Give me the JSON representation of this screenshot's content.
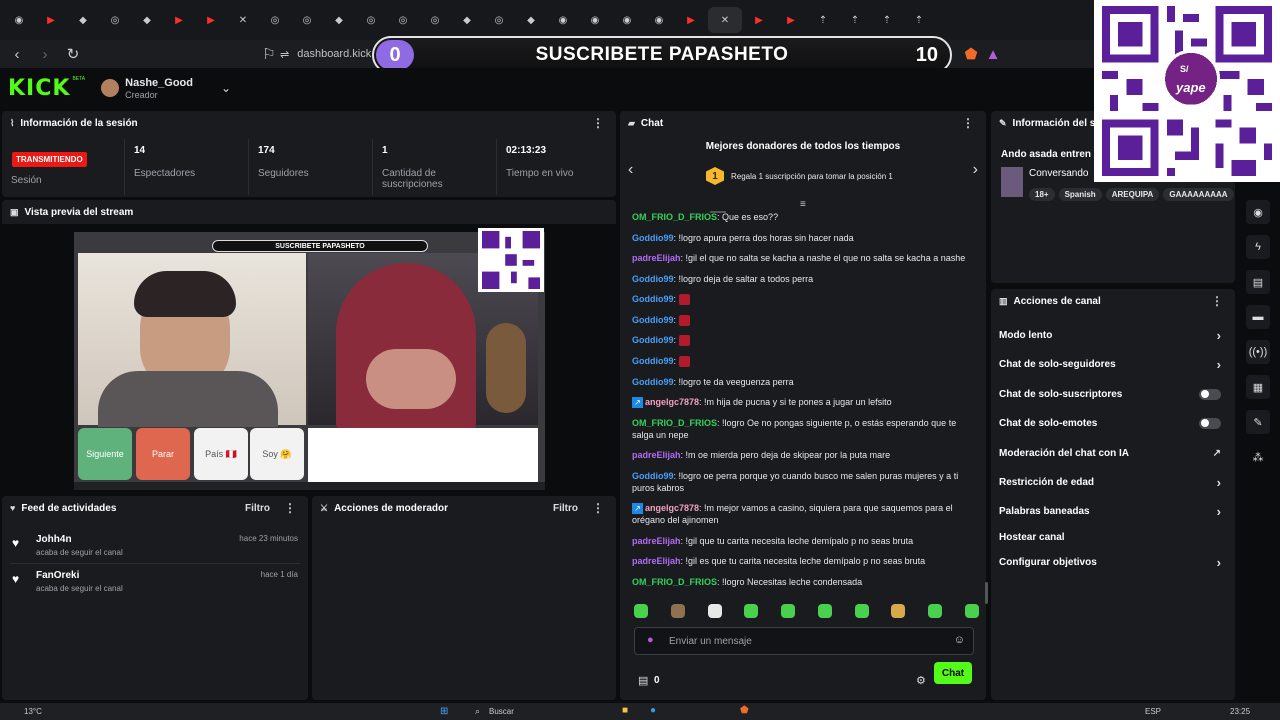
{
  "browser": {
    "url": "dashboard.kick.com/creator/nashe-good"
  },
  "overlay": {
    "sub_count": "0",
    "title": "SUSCRIBETE PAPASHETO",
    "goal": "10",
    "qr_brand": "yape",
    "qr_currency": "S/"
  },
  "header": {
    "logo": "KICK",
    "beta": "BETA",
    "username": "Nashe_Good",
    "role": "Creador"
  },
  "session": {
    "title": "Información de la sesión",
    "status_badge": "TRANSMITIENDO",
    "status_label": "Sesión",
    "stats": [
      {
        "value": "14",
        "label": "Espectadores"
      },
      {
        "value": "174",
        "label": "Seguidores"
      },
      {
        "value": "1",
        "label": "Cantidad de suscripciones"
      },
      {
        "value": "02:13:23",
        "label": "Tiempo en vivo"
      }
    ]
  },
  "preview": {
    "title": "Vista previa del stream",
    "buttons": [
      "Siguiente",
      "Parar",
      "País 🇵🇪",
      "Soy 🤗"
    ]
  },
  "feed": {
    "title": "Feed de actividades",
    "filter": "Filtro",
    "items": [
      {
        "name": "Johh4n",
        "desc": "acaba de seguir el canal",
        "time": "hace 23 minutos"
      },
      {
        "name": "FanOreki",
        "desc": "acaba de seguir el canal",
        "time": "hace 1 día"
      }
    ]
  },
  "moderator": {
    "title": "Acciones de moderador",
    "filter": "Filtro"
  },
  "chat": {
    "title": "Chat",
    "donors_title": "Mejores donadores de todos los tiempos",
    "donors_rank": "1",
    "donors_cta": "Regala 1 suscripción para tomar la posición 1",
    "messages": [
      {
        "user": "OM_FRIO_D_FRIOS",
        "text": "Que es eso??",
        "color": "#32d35a"
      },
      {
        "user": "Goddio99",
        "text": "!logro apura perra dos horas sin hacer nada",
        "color": "#4a9df8"
      },
      {
        "user": "padreElijah",
        "text": "!gil el que no salta se kacha a nashe el que no salta se kacha a nashe",
        "color": "#b26cf4"
      },
      {
        "user": "Goddio99",
        "text": "!logro deja de saltar a todos perra",
        "color": "#4a9df8"
      },
      {
        "user": "Goddio99",
        "text": "",
        "color": "#4a9df8",
        "emote": true
      },
      {
        "user": "Goddio99",
        "text": "",
        "color": "#4a9df8",
        "emote": true
      },
      {
        "user": "Goddio99",
        "text": "",
        "color": "#4a9df8",
        "emote": true
      },
      {
        "user": "Goddio99",
        "text": "",
        "color": "#4a9df8",
        "emote": true
      },
      {
        "user": "Goddio99",
        "text": "!logro te da veeguenza perra",
        "color": "#4a9df8"
      },
      {
        "user": "angelgc7878",
        "text": "!m hija de pucna y si te pones a jugar un lefsito",
        "color": "#f2a2c0",
        "badge": true
      },
      {
        "user": "OM_FRIO_D_FRIOS",
        "text": "!logro Oe no pongas siguiente p, o estás esperando que te salga un nepe",
        "color": "#32d35a"
      },
      {
        "user": "padreElijah",
        "text": "!m oe mierda pero deja de skipear por la puta mare",
        "color": "#b26cf4"
      },
      {
        "user": "Goddio99",
        "text": "!logro oe perra porque yo cuando busco me salen puras mujeres y a ti puros kabros",
        "color": "#4a9df8"
      },
      {
        "user": "angelgc7878",
        "text": "!m mejor vamos a casino, siquiera para que saquemos para el orégano del ajinomen",
        "color": "#f2a2c0",
        "badge": true
      },
      {
        "user": "padreElijah",
        "text": "!gil que tu carita necesita leche demípalo p no seas bruta",
        "color": "#b26cf4"
      },
      {
        "user": "padreElijah",
        "text": "!gil es que tu carita necesita leche demípalo p no seas bruta",
        "color": "#b26cf4"
      },
      {
        "user": "OM_FRIO_D_FRIOS",
        "text": "!logro Necesitas leche condensada",
        "color": "#32d35a"
      }
    ],
    "input_placeholder": "Enviar un mensaje",
    "points": "0",
    "send_label": "Chat"
  },
  "stream_info": {
    "title": "Información del stream",
    "stream_title": "Ando asada entren n",
    "category": "Conversando",
    "tags": [
      "18+",
      "Spanish",
      "AREQUIPA",
      "GAAAAAAAAA"
    ]
  },
  "channel_actions": {
    "title": "Acciones de canal",
    "items": [
      {
        "label": "Modo lento",
        "kind": "chevron"
      },
      {
        "label": "Chat de solo-seguidores",
        "kind": "chevron"
      },
      {
        "label": "Chat de solo-suscriptores",
        "kind": "toggle"
      },
      {
        "label": "Chat de solo-emotes",
        "kind": "toggle"
      },
      {
        "label": "Moderación del chat con IA",
        "kind": "external"
      },
      {
        "label": "Restricción de edad",
        "kind": "chevron"
      },
      {
        "label": "Palabras baneadas",
        "kind": "chevron"
      },
      {
        "label": "Hostear canal",
        "kind": "none"
      },
      {
        "label": "Configurar objetivos",
        "kind": "chevron"
      }
    ]
  },
  "taskbar": {
    "weather": "13°C",
    "search": "Buscar",
    "lang": "ESP",
    "time": "23:25"
  },
  "colors": {
    "kick_green": "#53fc18",
    "live_red": "#e91916",
    "panel": "#1a1b1f",
    "bg": "#0b0c0e"
  }
}
